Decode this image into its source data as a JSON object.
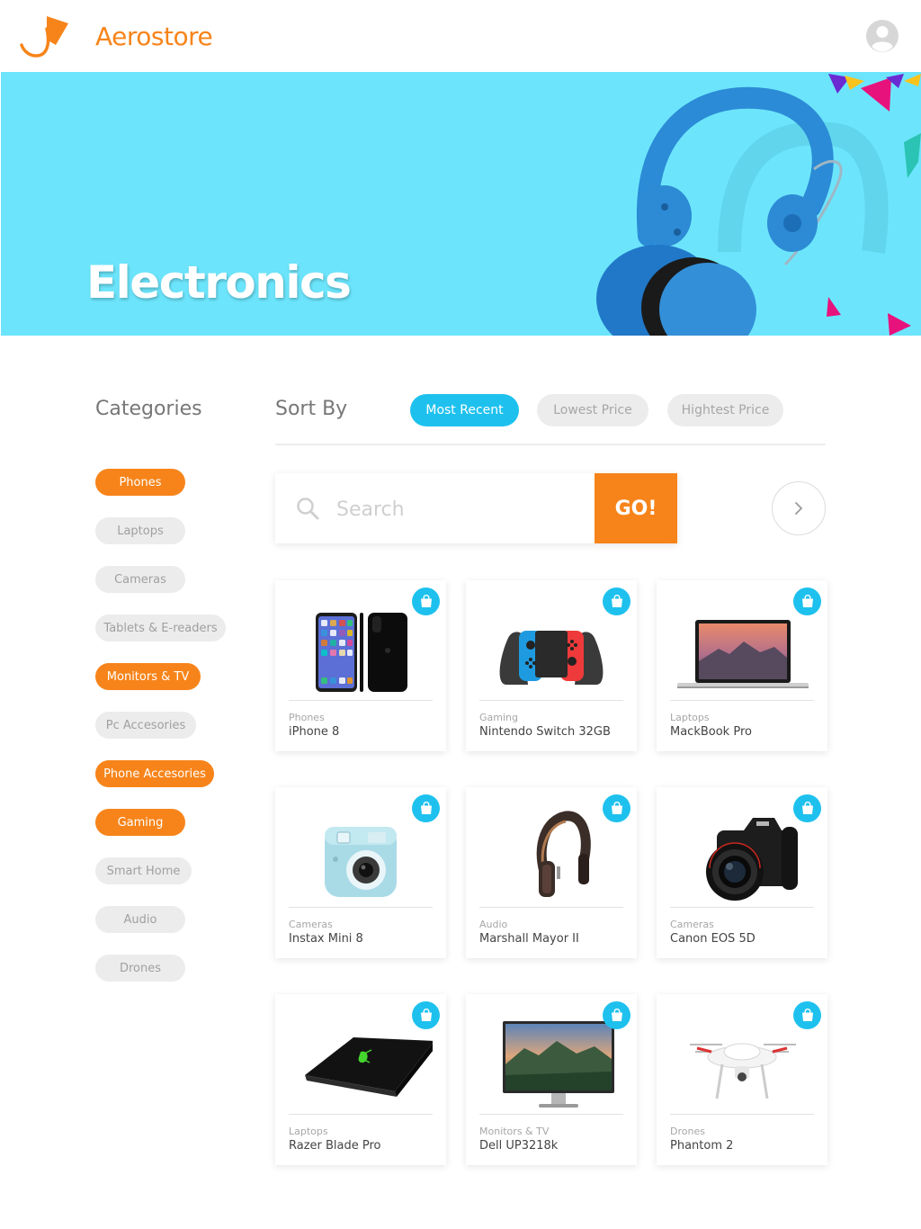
{
  "header": {
    "brand": "Aerostore",
    "brand_color": "#f7841a",
    "avatar_icon": "user-avatar-icon"
  },
  "hero": {
    "title": "Electronics",
    "background": "#6ce5fc"
  },
  "categories": {
    "heading": "Categories",
    "items": [
      {
        "label": "Phones",
        "selected": true
      },
      {
        "label": "Laptops",
        "selected": false
      },
      {
        "label": "Cameras",
        "selected": false
      },
      {
        "label": "Tablets & E-readers",
        "selected": false
      },
      {
        "label": "Monitors & TV",
        "selected": true
      },
      {
        "label": "Pc Accesories",
        "selected": false
      },
      {
        "label": "Phone Accesories",
        "selected": true
      },
      {
        "label": "Gaming",
        "selected": true
      },
      {
        "label": "Smart Home",
        "selected": false
      },
      {
        "label": "Audio",
        "selected": false
      },
      {
        "label": "Drones",
        "selected": false
      }
    ]
  },
  "sort": {
    "heading": "Sort By",
    "options": [
      {
        "label": "Most Recent",
        "active": true
      },
      {
        "label": "Lowest Price",
        "active": false
      },
      {
        "label": "Hightest Price",
        "active": false
      }
    ]
  },
  "search": {
    "placeholder": "Search",
    "go_label": "GO!",
    "search_icon": "search-icon",
    "next_icon": "chevron-right-icon"
  },
  "products": [
    {
      "category": "Phones",
      "name": "iPhone 8",
      "image": "iphone"
    },
    {
      "category": "Gaming",
      "name": "Nintendo Switch 32GB",
      "image": "switch"
    },
    {
      "category": "Laptops",
      "name": "MackBook Pro",
      "image": "macbook"
    },
    {
      "category": "Cameras",
      "name": "Instax Mini 8",
      "image": "instax"
    },
    {
      "category": "Audio",
      "name": "Marshall Mayor II",
      "image": "headphones"
    },
    {
      "category": "Cameras",
      "name": "Canon EOS 5D",
      "image": "dslr"
    },
    {
      "category": "Laptops",
      "name": "Razer Blade Pro",
      "image": "razer"
    },
    {
      "category": "Monitors & TV",
      "name": "Dell UP3218k",
      "image": "monitor"
    },
    {
      "category": "Drones",
      "name": "Phantom 2",
      "image": "drone"
    }
  ],
  "colors": {
    "accent_orange": "#f7841a",
    "accent_cyan": "#1ec1ee",
    "pill_inactive": "#ececec"
  }
}
